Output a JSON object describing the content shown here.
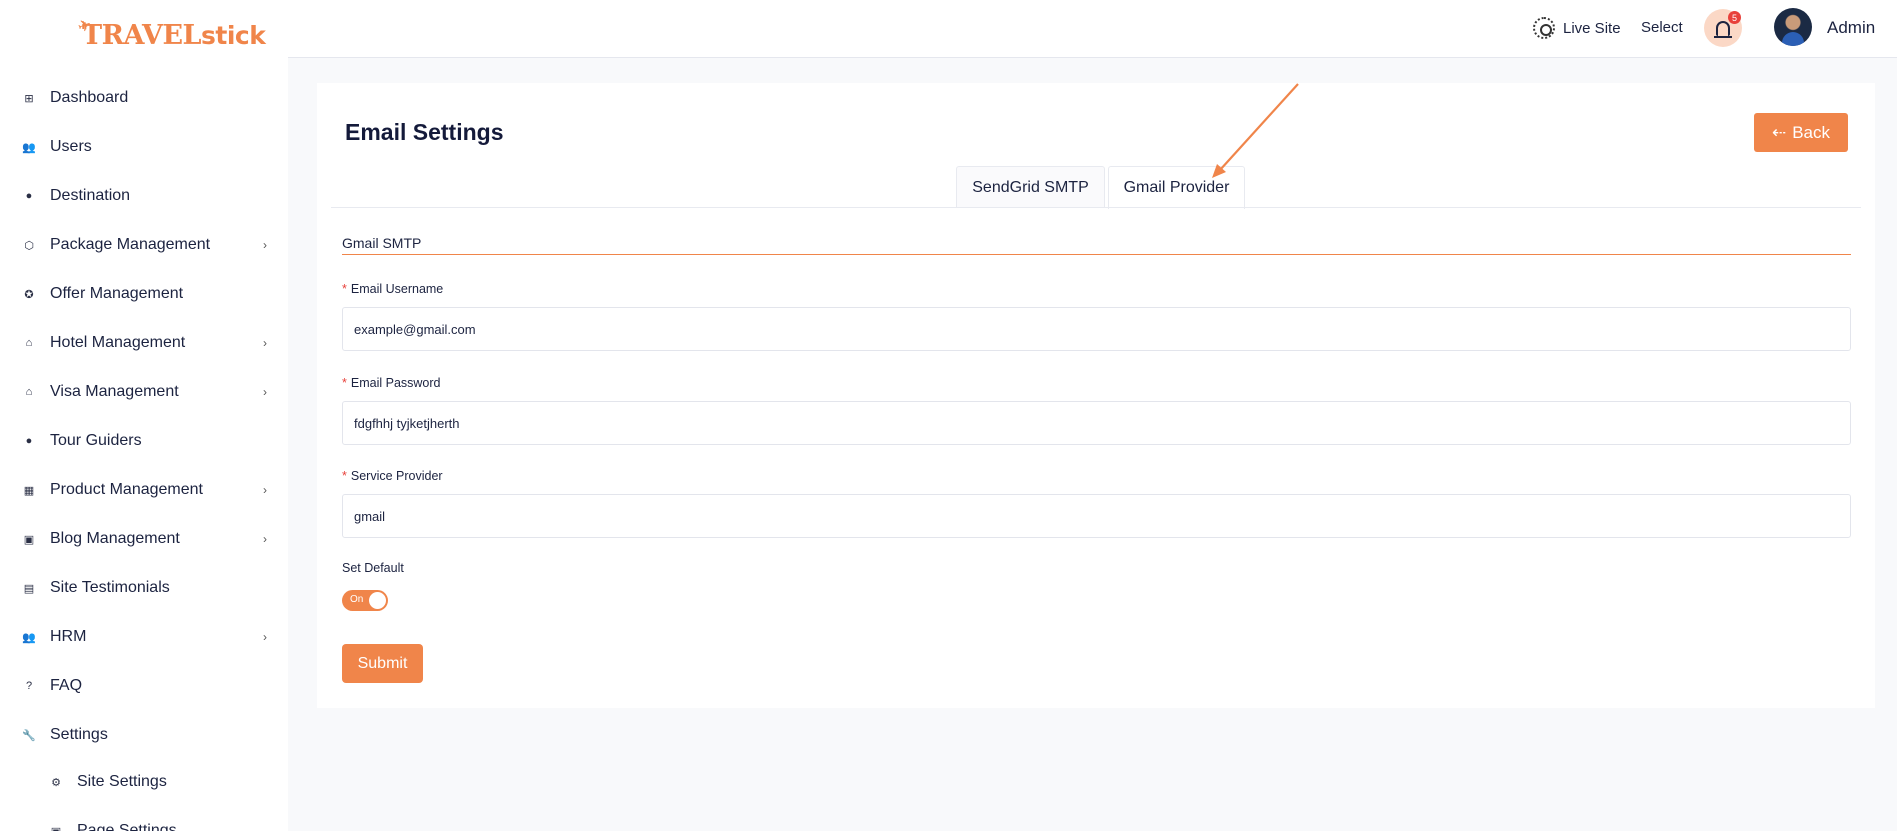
{
  "brand": {
    "logo_part1": "TRAVEL",
    "logo_part2": "stick"
  },
  "sidebar": {
    "items": [
      {
        "label": "Dashboard",
        "icon": "dashboard-icon",
        "glyph": "⊞",
        "has_chevron": false
      },
      {
        "label": "Users",
        "icon": "users-icon",
        "glyph": "👥",
        "has_chevron": false
      },
      {
        "label": "Destination",
        "icon": "location-icon",
        "glyph": "●",
        "has_chevron": false
      },
      {
        "label": "Package Management",
        "icon": "box-icon",
        "glyph": "⬡",
        "has_chevron": true
      },
      {
        "label": "Offer Management",
        "icon": "offer-icon",
        "glyph": "✪",
        "has_chevron": false
      },
      {
        "label": "Hotel Management",
        "icon": "hotel-icon",
        "glyph": "⌂",
        "has_chevron": true
      },
      {
        "label": "Visa Management",
        "icon": "visa-icon",
        "glyph": "⌂",
        "has_chevron": true
      },
      {
        "label": "Tour Guiders",
        "icon": "person-icon",
        "glyph": "●",
        "has_chevron": false
      },
      {
        "label": "Product Management",
        "icon": "grid-icon",
        "glyph": "▦",
        "has_chevron": true
      },
      {
        "label": "Blog Management",
        "icon": "blog-icon",
        "glyph": "▣",
        "has_chevron": true
      },
      {
        "label": "Site Testimonials",
        "icon": "comment-icon",
        "glyph": "▤",
        "has_chevron": false
      },
      {
        "label": "HRM",
        "icon": "team-icon",
        "glyph": "👥",
        "has_chevron": true
      },
      {
        "label": "FAQ",
        "icon": "question-icon",
        "glyph": "?",
        "has_chevron": false
      },
      {
        "label": "Settings",
        "icon": "wrench-icon",
        "glyph": "🔧",
        "has_chevron": false
      }
    ],
    "sub_items": [
      {
        "label": "Site Settings",
        "icon": "gear-icon",
        "glyph": "⚙"
      },
      {
        "label": "Page Settings",
        "icon": "page-icon",
        "glyph": "▣"
      }
    ]
  },
  "topbar": {
    "live_site": "Live Site",
    "select": "Select",
    "notifications_count": "5",
    "user_name": "Admin"
  },
  "page": {
    "title": "Email Settings",
    "back_label": "Back",
    "tabs": [
      {
        "label": "SendGrid SMTP",
        "active": false
      },
      {
        "label": "Gmail Provider",
        "active": true
      }
    ],
    "section_title": "Gmail SMTP",
    "fields": [
      {
        "label": "Email Username",
        "value": "example@gmail.com",
        "required": true
      },
      {
        "label": "Email Password",
        "value": "fdgfhhj tyjketjherth",
        "required": true
      },
      {
        "label": "Service Provider",
        "value": "gmail",
        "required": true
      }
    ],
    "set_default_label": "Set Default",
    "toggle_label": "On",
    "toggle_on": true,
    "submit_label": "Submit"
  },
  "colors": {
    "accent": "#f0854a",
    "text": "#1c2340",
    "required": "#e8413b"
  }
}
